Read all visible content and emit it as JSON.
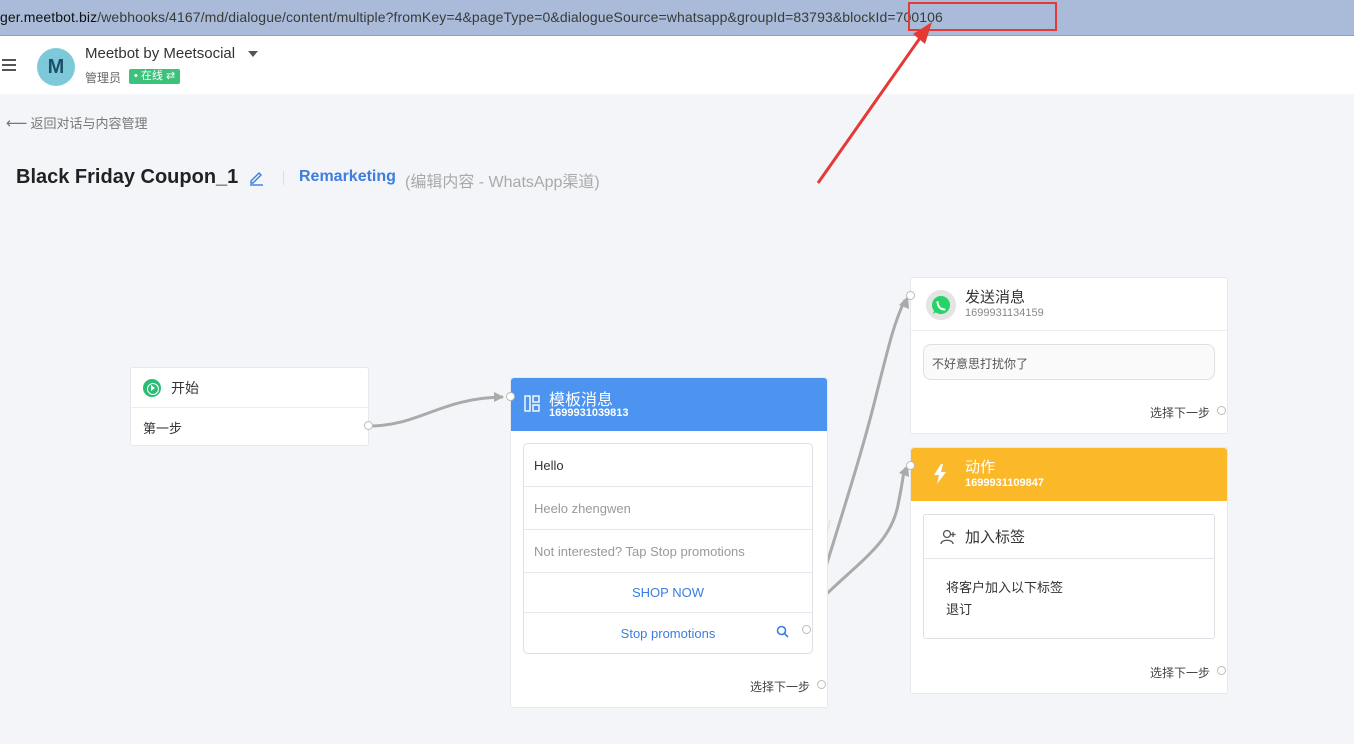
{
  "browser": {
    "url_host": "ger.meetbot.biz",
    "url_path": "/webhooks/4167/md/dialogue/content/multiple?fromKey=4&pageType=0&dialogueSource=whatsapp&groupId=83793&blockId=700106"
  },
  "header": {
    "avatar_letter": "M",
    "brand": "Meetbot by Meetsocial",
    "role": "管理员",
    "status": "• 在线 ⇄"
  },
  "nav": {
    "back_label": "返回对话与内容管理"
  },
  "page": {
    "title": "Black Friday Coupon_1",
    "category": "Remarketing",
    "note": "(编辑内容 - WhatsApp渠道)"
  },
  "nodes": {
    "start": {
      "title": "开始",
      "step": "第一步"
    },
    "template": {
      "title": "模板消息",
      "id": "1699931039813",
      "rows": [
        "Hello",
        "Heelo zhengwen",
        "Not interested? Tap Stop promotions"
      ],
      "buttons": [
        "SHOP NOW",
        "Stop promotions"
      ],
      "next_label": "选择下一步"
    },
    "send": {
      "title": "发送消息",
      "id": "1699931134159",
      "message": "不好意思打扰你了",
      "next_label": "选择下一步"
    },
    "action": {
      "title": "动作",
      "id": "1699931109847",
      "card_title": "加入标签",
      "description": "将客户加入以下标签",
      "tag": "退订",
      "next_label": "选择下一步"
    }
  },
  "colors": {
    "template_header": "#4d94f0",
    "action_header": "#fbb829",
    "link": "#3b7de0",
    "online": "#3cc27a",
    "annotation": "#e53935"
  }
}
